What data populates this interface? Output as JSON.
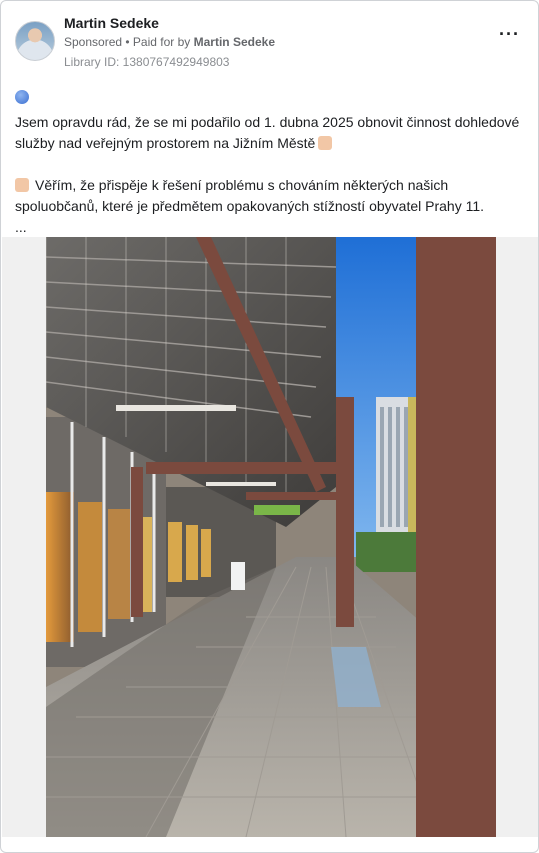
{
  "post": {
    "author_name": "Martin Sedeke",
    "sponsored_label": "Sponsored",
    "separator": " • ",
    "paid_prefix": "Paid for by ",
    "paid_by": "Martin Sedeke",
    "library_id": "Library ID: 1380767492949803",
    "more_icon": "···",
    "paragraph_1": "Jsem opravdu rád, že se mi podařilo od 1. dubna 2025 obnovit činnost dohledové služby nad veřejným prostorem na Jižním Městě",
    "paragraph_2": "Věřím, že přispěje k řešení problému s chováním některých našich spoluobčanů, které je předmětem opakovaných stížností obyvatel Prahy 11.",
    "truncation": "..."
  },
  "icons": {
    "dot": "blue-circle-icon",
    "hand_1": "hand-icon",
    "hand_2": "pointing-hand-icon"
  },
  "colors": {
    "text": "#1c1e21",
    "secondary": "#65676b",
    "sky": "#3d8ee6",
    "beam": "#7b4a3e"
  }
}
